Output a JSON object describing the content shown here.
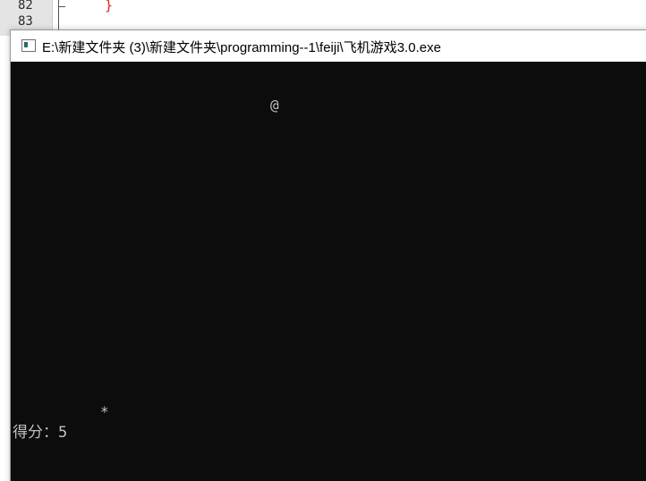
{
  "editor": {
    "line_numbers": [
      "82",
      "83"
    ],
    "code_line": "}"
  },
  "console": {
    "title": "E:\\新建文件夹 (3)\\新建文件夹\\programming--1\\feiji\\飞机游戏3.0.exe",
    "icon": "console-app-icon",
    "plane_char": "@",
    "enemy_char": "*",
    "score_label": "得分：",
    "score_value": "5"
  },
  "colors": {
    "console_background": "#0c0c0c",
    "console_text": "#c0c0c0",
    "brace_color": "#e0201b"
  }
}
